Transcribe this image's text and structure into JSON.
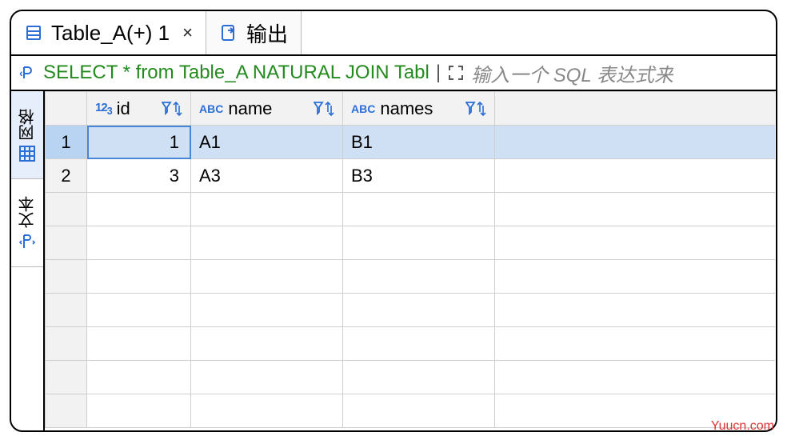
{
  "tabs": {
    "active": {
      "label": "Table_A(+) 1"
    },
    "output": {
      "label": "输出"
    },
    "close_glyph": "×"
  },
  "sql": {
    "prefix_icon": "sql-edit-icon",
    "query": "SELECT * from Table_A NATURAL JOIN Tabl",
    "expand_icon": "expand-icon",
    "placeholder": "输入一个 SQL 表达式来"
  },
  "sidebar": {
    "grid": {
      "label": "网格"
    },
    "text": {
      "label": "文本"
    }
  },
  "columns": [
    {
      "name": "id",
      "type": "123"
    },
    {
      "name": "name",
      "type": "ABC"
    },
    {
      "name": "names",
      "type": "ABC"
    }
  ],
  "rows": [
    {
      "n": "1",
      "cells": [
        "1",
        "A1",
        "B1"
      ],
      "selected": true
    },
    {
      "n": "2",
      "cells": [
        "3",
        "A3",
        "B3"
      ],
      "selected": false
    }
  ],
  "watermark": "Yuucn.com"
}
